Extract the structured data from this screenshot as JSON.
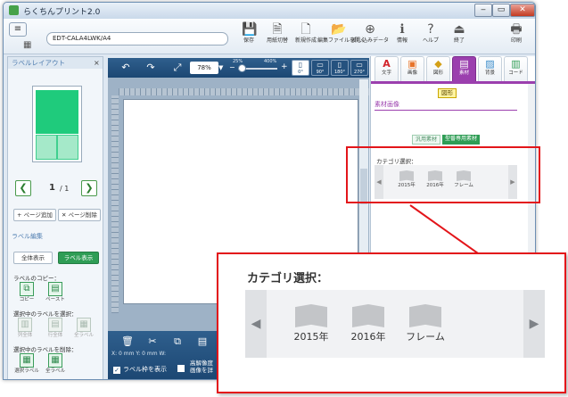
{
  "window": {
    "title": "らくちんプリント2.0",
    "controls": {
      "minimize": "‒",
      "maximize": "▭",
      "close": "✕"
    }
  },
  "toolbar": {
    "doc_name": "EDT-CALA4LWK/A4",
    "buttons": [
      {
        "id": "save",
        "label": "保存",
        "icon": "save-icon",
        "glyph": "💾"
      },
      {
        "id": "paper",
        "label": "用紙切替",
        "icon": "paper-switch-icon",
        "glyph": "🗎"
      },
      {
        "id": "new",
        "label": "新規作成",
        "icon": "new-document-icon",
        "glyph": "🗋"
      },
      {
        "id": "open",
        "label": "編集ファイルを開く",
        "icon": "open-file-icon",
        "glyph": "📂"
      },
      {
        "id": "merge",
        "label": "差し込みデータ",
        "icon": "merge-data-icon",
        "glyph": "⊕"
      },
      {
        "id": "info",
        "label": "情報",
        "icon": "info-icon",
        "glyph": "ℹ"
      },
      {
        "id": "help",
        "label": "ヘルプ",
        "icon": "help-icon",
        "glyph": "?"
      },
      {
        "id": "exit",
        "label": "終了",
        "icon": "exit-icon",
        "glyph": "⏏"
      },
      {
        "id": "print",
        "label": "印刷",
        "icon": "printer-icon",
        "glyph": "🖶"
      }
    ]
  },
  "left_panel": {
    "title": "ラベルレイアウト",
    "close": "×",
    "page": {
      "current": "1",
      "total": "/ 1"
    },
    "prev": "❮",
    "next": "❯",
    "add_page": "+ ページ追加",
    "delete_page": "✕ ページ削除",
    "edit_section": "ラベル編集",
    "show_all": "全体表示",
    "show_label": "ラベル表示",
    "copy_head": "ラベルのコピー：",
    "copy": "コピー",
    "paste": "ペースト",
    "select_head": "選択中のラベルを選択：",
    "select_items": [
      "列全体",
      "行全体",
      "全ラベル"
    ],
    "delete_head": "選択中のラベルを削除：",
    "delete_items": [
      "選択ラベル",
      "全ラベル"
    ]
  },
  "canvas": {
    "zoom": "78%",
    "zoom_min": "25%",
    "zoom_max": "400%",
    "rotations": [
      "0°",
      "90°",
      "180°",
      "270°"
    ],
    "coords": "X:  0 mm Y:  0 mm  W:",
    "show_frame": "ラベル枠を表示",
    "hq_label": "高解像度",
    "hq_label2": "画像を詳"
  },
  "right_panel": {
    "tabs": [
      {
        "id": "text",
        "label": "文字",
        "glyph": "A",
        "color": "#d2232a"
      },
      {
        "id": "image",
        "label": "画像",
        "glyph": "▣",
        "color": "#e8742b"
      },
      {
        "id": "shape",
        "label": "図形",
        "glyph": "◆",
        "color": "#d4a017"
      },
      {
        "id": "material",
        "label": "素材",
        "glyph": "▤",
        "color": "#ffffff"
      },
      {
        "id": "background",
        "label": "背景",
        "glyph": "▨",
        "color": "#3a8bc9"
      },
      {
        "id": "code",
        "label": "コード",
        "glyph": "▥",
        "color": "#2f9d55"
      }
    ],
    "badge": "図形",
    "section": "素材画像",
    "sub_tab_general": "汎用素材",
    "sub_tab_specific": "型番専用素材",
    "category_label": "カテゴリ選択：",
    "categories": [
      "2015年",
      "2016年",
      "フレーム"
    ]
  },
  "callout": {
    "title": "カテゴリ選択：",
    "categories": [
      "2015年",
      "2016年",
      "フレーム"
    ],
    "left_arrow": "◀",
    "right_arrow": "▶"
  },
  "colors": {
    "accent": "#9b3fae",
    "highlight": "#e3151a",
    "toolbar": "#1c4773",
    "label_fill": "#1fcb7c"
  }
}
